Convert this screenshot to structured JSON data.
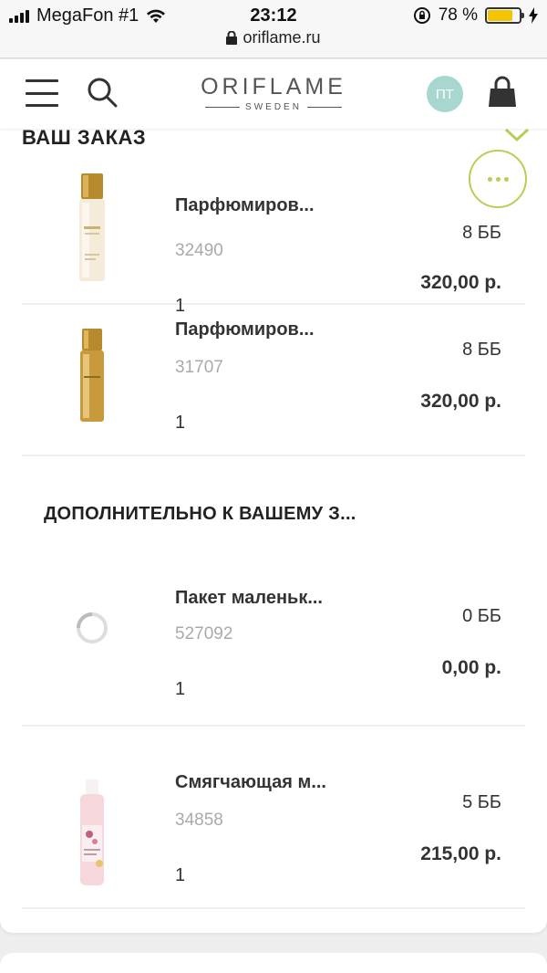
{
  "status_bar": {
    "carrier": "MegaFon #1",
    "time": "23:12",
    "battery": "78 %",
    "battery_level": 0.78,
    "url": "oriflame.ru"
  },
  "header": {
    "logo_main": "ORIFLAME",
    "logo_sub": "SWEDEN",
    "avatar_initials": "ПТ"
  },
  "order": {
    "title": "ВАШ ЗАКАЗ",
    "items": [
      {
        "name": "Парфюмиров...",
        "code": "32490",
        "qty": "1",
        "points": "8 ББ",
        "price": "320,00 р."
      },
      {
        "name": "Парфюмиров...",
        "code": "31707",
        "qty": "1",
        "points": "8 ББ",
        "price": "320,00 р."
      }
    ]
  },
  "extra": {
    "title": "ДОПОЛНИТЕЛЬНО К ВАШЕМУ З...",
    "items": [
      {
        "name": "Пакет маленьк...",
        "code": "527092",
        "qty": "1",
        "points": "0 ББ",
        "price": "0,00 р."
      },
      {
        "name": "Смягчающая м...",
        "code": "34858",
        "qty": "1",
        "points": "5 ББ",
        "price": "215,00 р."
      }
    ]
  },
  "colors": {
    "accent": "#b6cf55",
    "avatar": "#a7d7ce",
    "battery": "#f5c400"
  }
}
